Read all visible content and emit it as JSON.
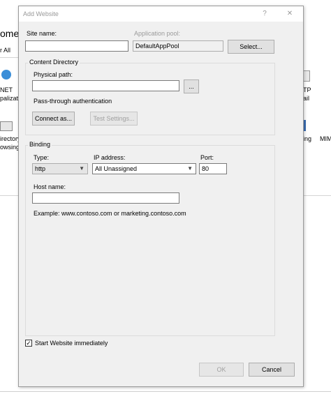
{
  "background": {
    "frag_ome": "ome",
    "frag_all": "r All",
    "frag_net": "NET",
    "frag_palizat": "palizat",
    "frag_irectory": "irectory",
    "frag_owsing": "owsing",
    "frag_tp": "TP",
    "frag_ail": "ail",
    "frag_ing": "ing",
    "frag_mim": "MIM"
  },
  "dialog": {
    "title": "Add Website",
    "help_label": "?",
    "close_label": "✕",
    "site_name_label": "Site name:",
    "site_name_value": "",
    "app_pool_label": "Application pool:",
    "app_pool_value": "DefaultAppPool",
    "select_button": "Select...",
    "content_dir_title": "Content Directory",
    "physical_path_label": "Physical path:",
    "physical_path_value": "",
    "browse_button": "...",
    "passthrough_label": "Pass-through authentication",
    "connect_as_button": "Connect as...",
    "test_settings_button": "Test Settings...",
    "binding_title": "Binding",
    "type_label": "Type:",
    "type_value": "http",
    "ip_label": "IP address:",
    "ip_value": "All Unassigned",
    "port_label": "Port:",
    "port_value": "80",
    "host_name_label": "Host name:",
    "host_name_value": "",
    "example_text": "Example: www.contoso.com or marketing.contoso.com",
    "start_label": "Start Website immediately",
    "start_checked": true,
    "ok_button": "OK",
    "cancel_button": "Cancel"
  }
}
